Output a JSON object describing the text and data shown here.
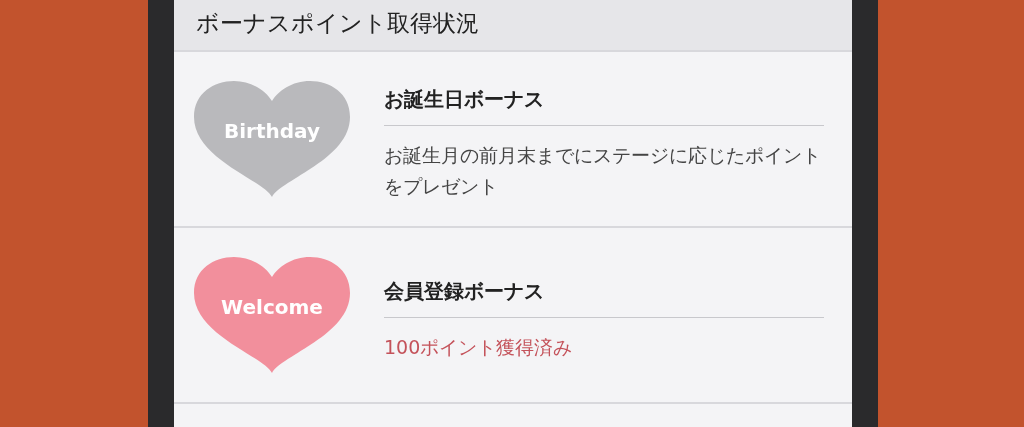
{
  "section_title": "ボーナスポイント取得状況",
  "bonuses": [
    {
      "badge": "Birthday",
      "color": "#b9b9bc",
      "title": "お誕生日ボーナス",
      "detail": "お誕生月の前月末までにステージに応じたポイントをプレゼント",
      "kind": "description"
    },
    {
      "badge": "Welcome",
      "color": "#f28f9c",
      "title": "会員登録ボーナス",
      "detail": "100ポイント獲得済み",
      "kind": "status"
    }
  ]
}
